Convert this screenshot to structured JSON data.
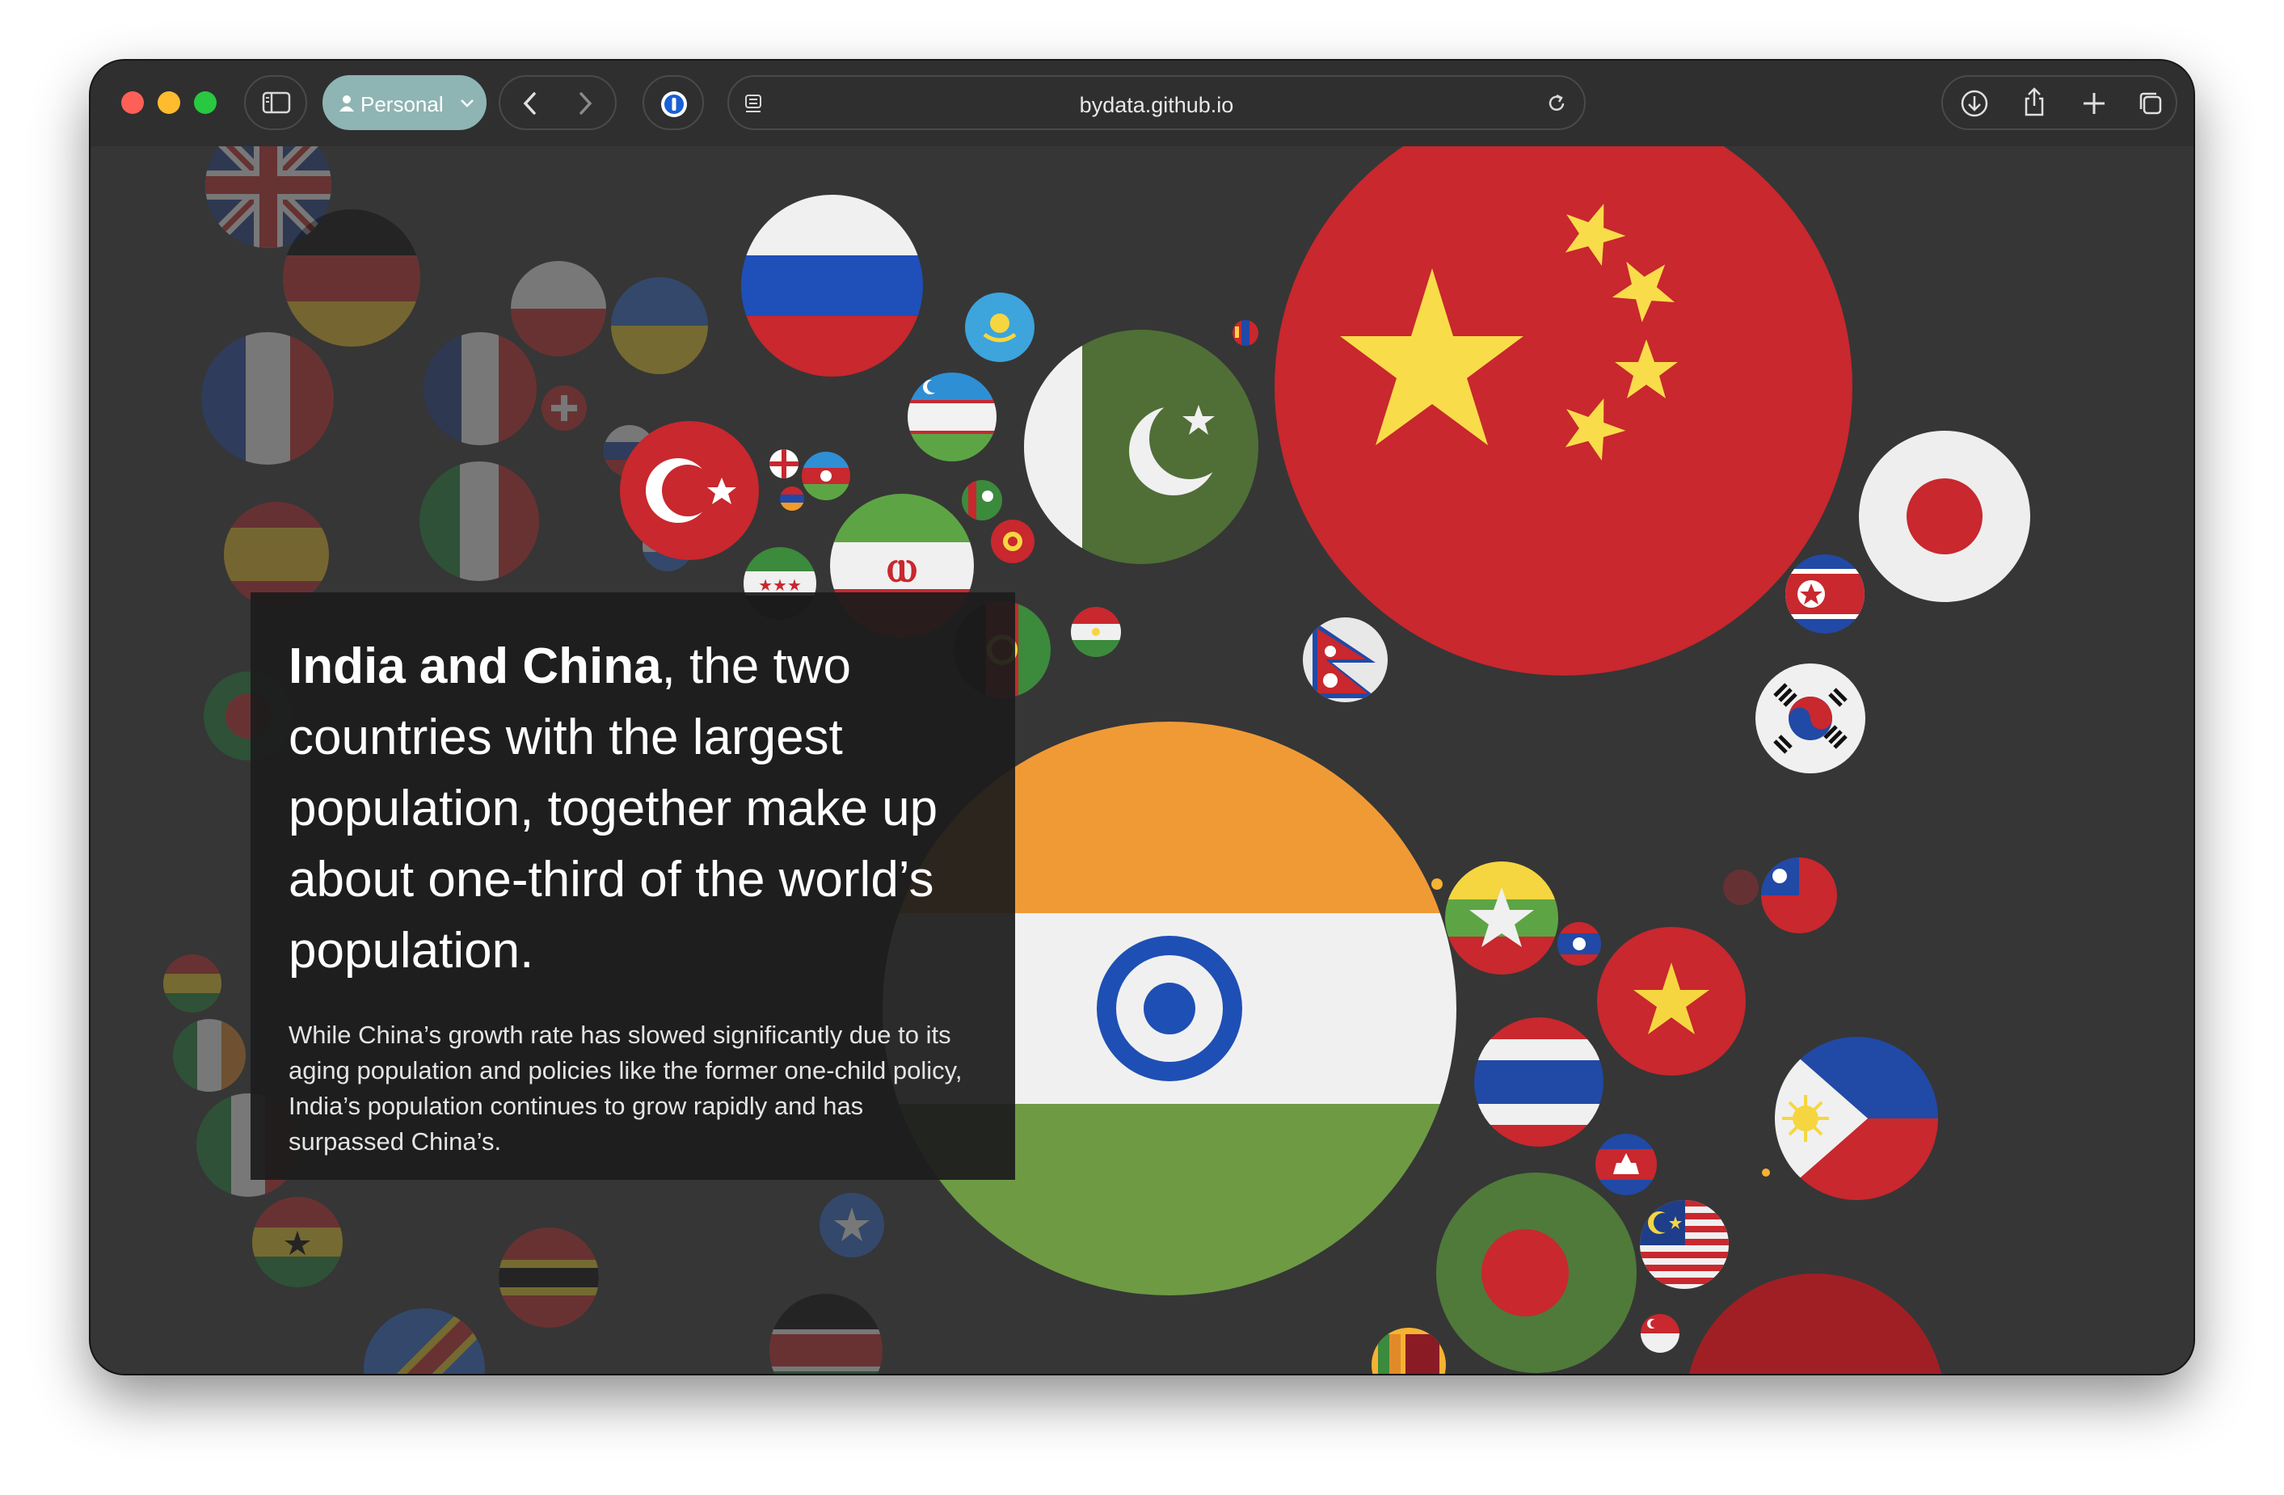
{
  "browser": {
    "profile_label": "Personal",
    "url": "bydata.github.io"
  },
  "story": {
    "headline_bold": "India and China",
    "headline_rest": ", the two countries with the largest population, together make up about one-third of the world’s population.",
    "body": "While China’s growth rate has slowed significantly due to its aging population and policies like the former one-child policy, India’s population continues to grow rapidly and has surpassed China’s."
  },
  "flags": {
    "china": "China",
    "india": "India",
    "russia": "Russia",
    "pakistan": "Pakistan",
    "japan": "Japan",
    "turkey": "Turkey",
    "iran": "Iran",
    "kazakhstan": "Kazakhstan",
    "uzbekistan": "Uzbekistan",
    "nepal": "Nepal",
    "north_korea": "North Korea",
    "south_korea": "South Korea",
    "taiwan": "Taiwan",
    "myanmar": "Myanmar",
    "laos": "Laos",
    "vietnam": "Vietnam",
    "thailand": "Thailand",
    "cambodia": "Cambodia",
    "philippines": "Philippines",
    "malaysia": "Malaysia",
    "bangladesh": "Bangladesh",
    "singapore": "Singapore",
    "indonesia": "Indonesia",
    "sri_lanka": "Sri Lanka",
    "mongolia": "Mongolia",
    "syria": "Syria",
    "tajikistan": "Tajikistan",
    "afghanistan": "Afghanistan",
    "kyrgyzstan": "Kyrgyzstan",
    "turkmenistan": "Turkmenistan",
    "georgia": "Georgia",
    "azerbaijan": "Azerbaijan",
    "armenia": "Armenia"
  },
  "colors": {
    "china_red": "#c8282e",
    "china_yellow": "#f9dc4a",
    "india_saffron": "#f09a36",
    "india_green": "#6e9a44",
    "india_chakra": "#1e4fb5",
    "russia_blue": "#1f4fb8",
    "pakistan_green": "#4f6f36",
    "background": "#363636"
  }
}
